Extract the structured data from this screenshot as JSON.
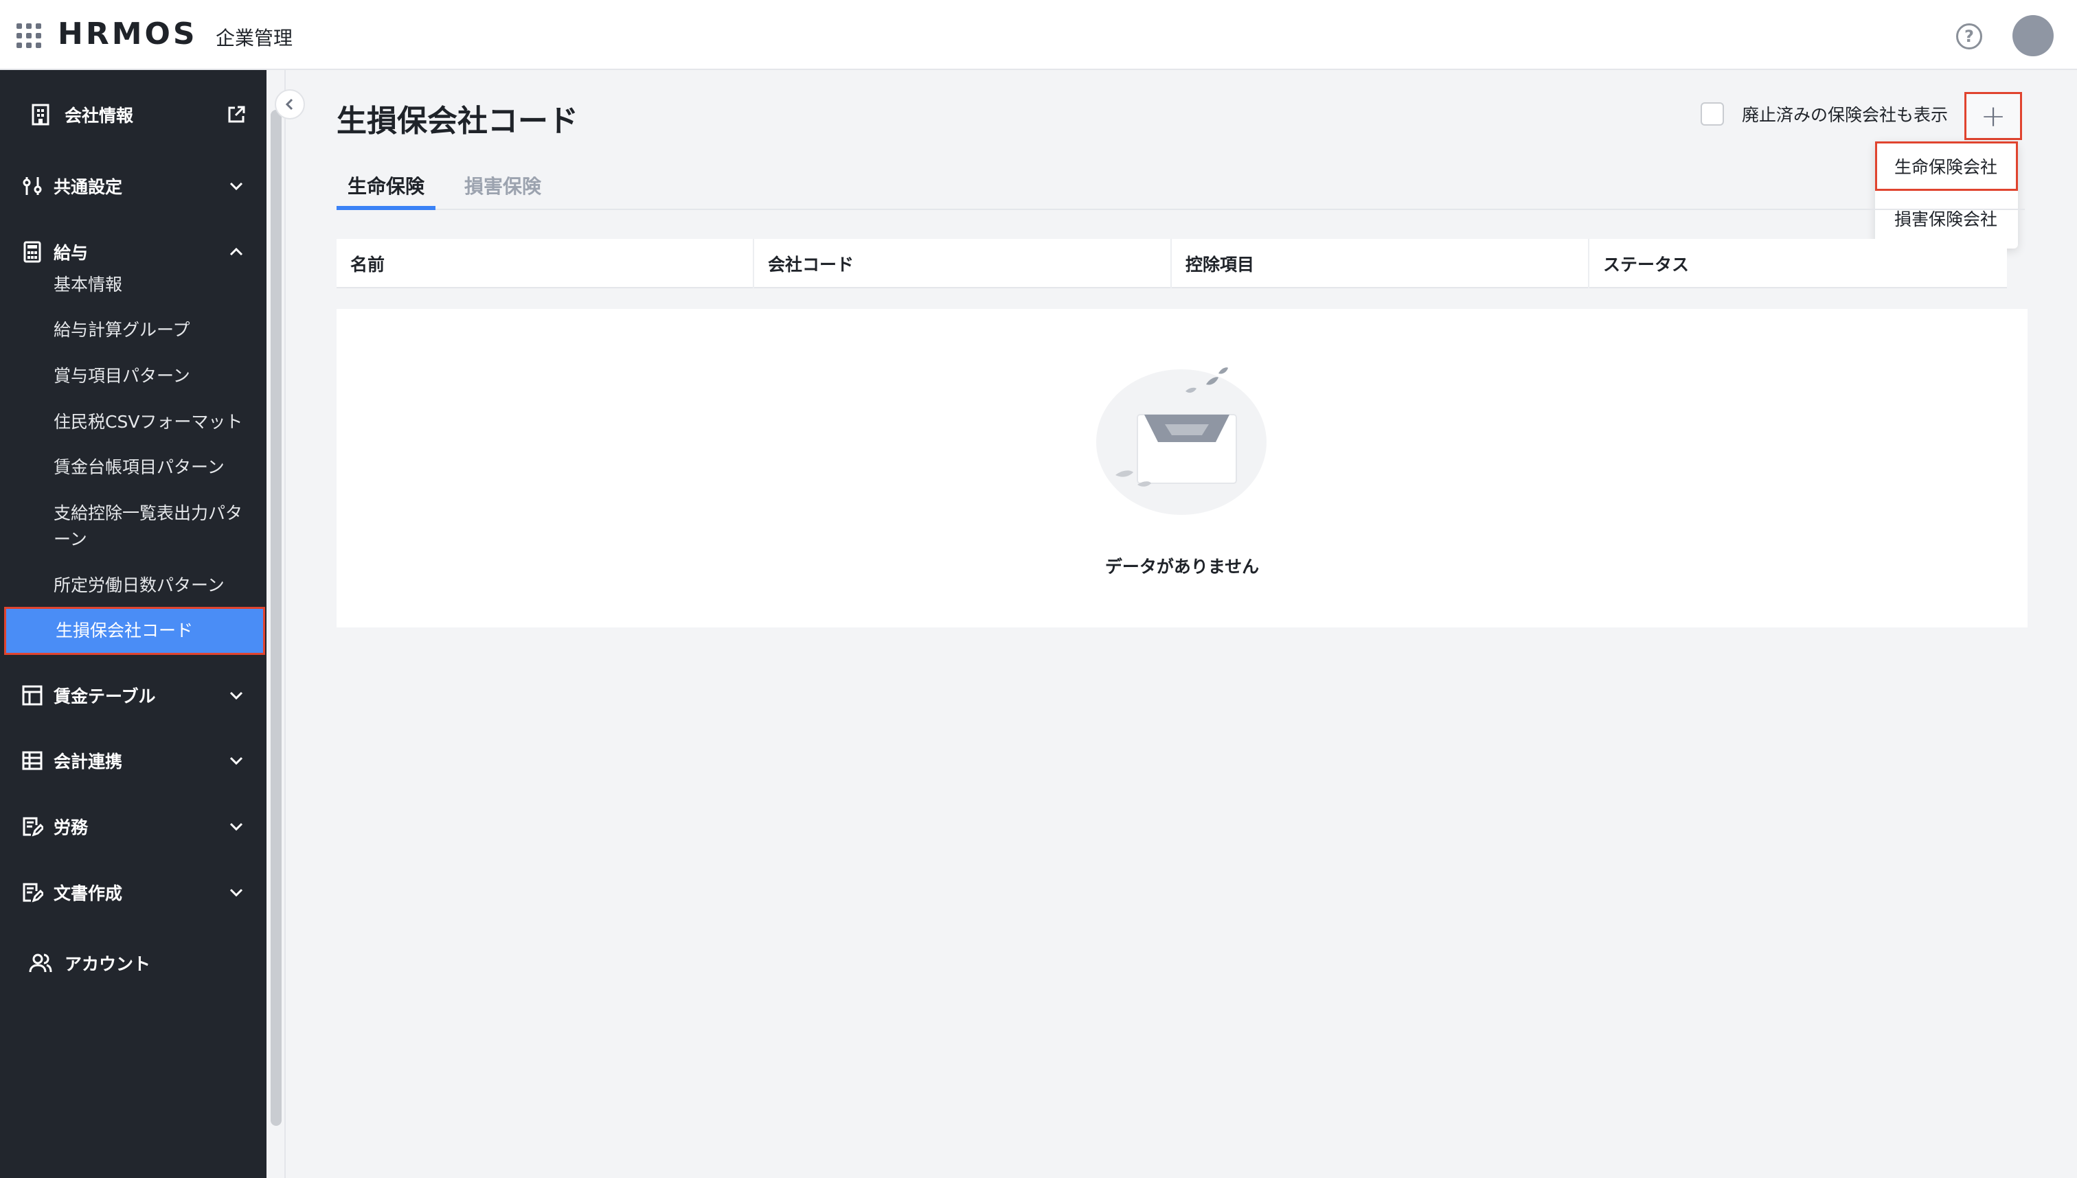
{
  "header": {
    "brand": "HRMOS",
    "brand_sub": "企業管理"
  },
  "sidebar": {
    "company_info": "会社情報",
    "common_settings": "共通設定",
    "payroll": "給与",
    "payroll_items": [
      "基本情報",
      "給与計算グループ",
      "賞与項目パターン",
      "住民税CSVフォーマット",
      "賃金台帳項目パターン",
      "支給控除一覧表出力パターン",
      "所定労働日数パターン",
      "生損保会社コード"
    ],
    "wage_table": "賃金テーブル",
    "accounting": "会計連携",
    "labor": "労務",
    "documents": "文書作成",
    "account": "アカウント"
  },
  "main": {
    "title": "生損保会社コード",
    "show_archived_label": "廃止済みの保険会社も表示",
    "show_archived_checked": false,
    "add_button": "+",
    "dropdown": [
      "生命保険会社",
      "損害保険会社"
    ],
    "tabs": [
      "生命保険",
      "損害保険"
    ],
    "columns": [
      "名前",
      "会社コード",
      "控除項目",
      "ステータス"
    ],
    "empty_text": "データがありません"
  },
  "colors": {
    "sidebar_bg": "#22262d",
    "active_item": "#4a8df6",
    "highlight_border": "#e0442f",
    "tab_accent": "#3b82f6"
  }
}
